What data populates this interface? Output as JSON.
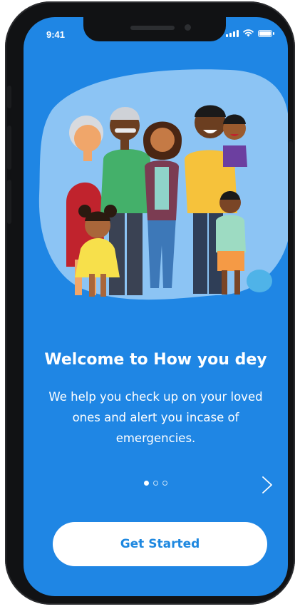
{
  "status_bar": {
    "time": "9:41",
    "icons": [
      "signal-icon",
      "wifi-icon",
      "battery-icon"
    ]
  },
  "onboarding": {
    "illustration": "family-group-illustration",
    "title": "Welcome to How you dey",
    "description": "We help you check up on your loved ones and alert you incase of emergencies.",
    "pager": {
      "total_pages": 3,
      "current_page": 1
    },
    "next_icon": "chevron-right-icon",
    "cta_label": "Get Started"
  },
  "colors": {
    "screen_background": "#1F86E4",
    "blob": "#8CC4F4",
    "button_background": "#FFFFFF",
    "button_text": "#1E88E0"
  }
}
